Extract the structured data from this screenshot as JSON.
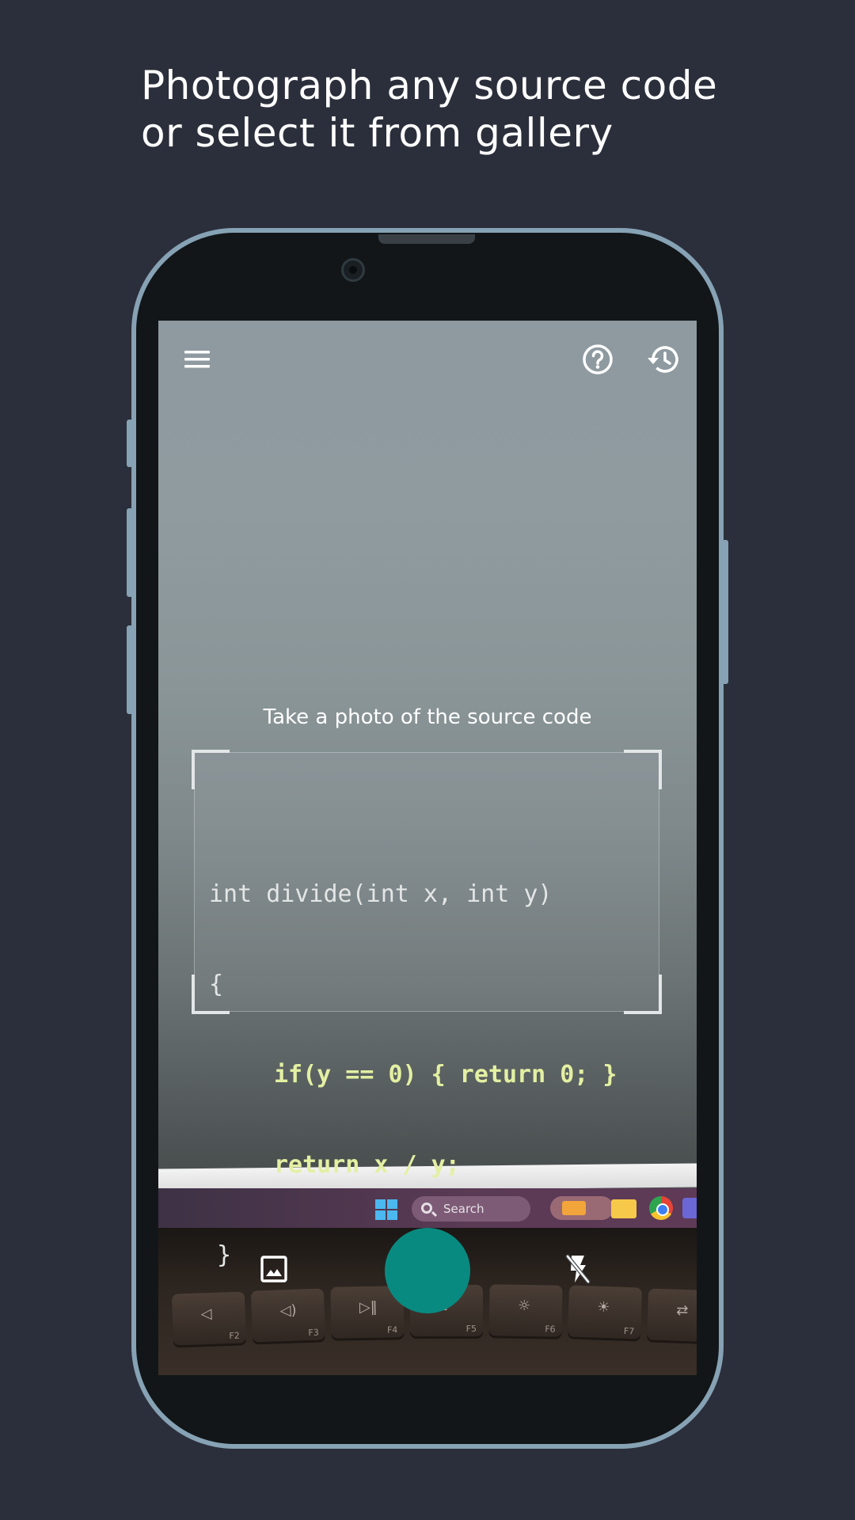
{
  "headline": {
    "line1": "Photograph any source code",
    "line2": "or select it from gallery"
  },
  "toolbar": {
    "menu_icon": "menu-icon",
    "help_icon": "help-circle-icon",
    "history_icon": "history-icon"
  },
  "camera": {
    "prompt": "Take a photo of the source code",
    "code_lines": [
      "int divide(int x, int y)",
      "{",
      "if(y == 0) { return 0; }",
      "return x / y;",
      "}"
    ],
    "taskbar_search": "Search",
    "keyboard_keys": [
      "F2",
      "F3",
      "F4",
      "F5",
      "F6",
      "F7"
    ]
  },
  "controls": {
    "gallery_icon": "image-gallery-icon",
    "shutter": "shutter-button",
    "flash_icon": "flash-off-icon"
  },
  "colors": {
    "background": "#2b2f3b",
    "accent": "#098a80",
    "phone_frame": "#86a2b4"
  }
}
